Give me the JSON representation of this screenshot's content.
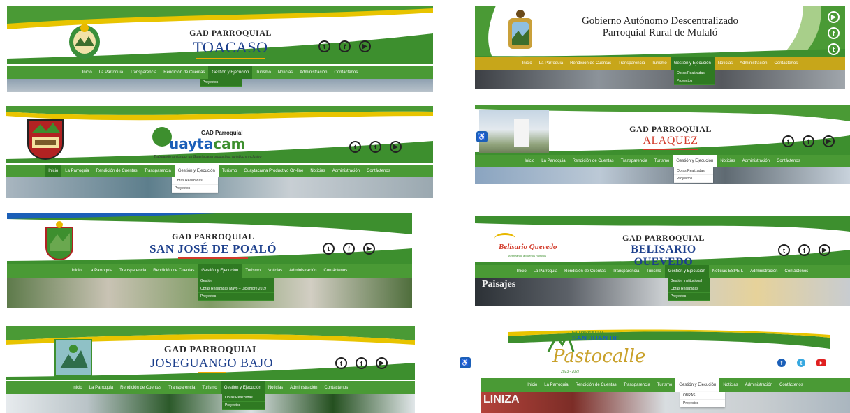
{
  "panels": {
    "toacaso": {
      "title_small": "GAD PARROQUIAL",
      "title_big": "TOACASO",
      "nav": [
        "Inicio",
        "La Parroquia",
        "Transparencia",
        "Rendición de Cuentas",
        "Gestión y Ejecución",
        "Turismo",
        "Noticias",
        "Administración",
        "Contáctenos"
      ],
      "dropdown": [
        "Proyectos"
      ]
    },
    "mulalo": {
      "title_line1": "Gobierno Autónomo Descentralizado",
      "title_line2": "Parroquial Rural de Mulaló",
      "nav": [
        "Inicio",
        "La Parroquia",
        "Rendición de Cuentas",
        "Transparencia",
        "Turismo",
        "Gestión y Ejecución",
        "Noticias",
        "Administración",
        "Contáctenos"
      ],
      "dropdown": [
        "Obras Realizadas",
        "Proyectos"
      ]
    },
    "guaytacama": {
      "logo_prefix": "uayta",
      "logo_suffix": "cam",
      "logo_gad": "GAD Parroquial",
      "tagline": "Trabajando juntos por un Guaytacama productivo, turístico e inclusivo",
      "nav": [
        "Inicio",
        "La Parroquia",
        "Rendición de Cuentas",
        "Transparencia",
        "Gestión y Ejecución",
        "Turismo",
        "Guaytacama Productivo On-line",
        "Noticias",
        "Administración",
        "Contáctenos"
      ],
      "dropdown": [
        "Obras Realizadas",
        "Proyectos"
      ]
    },
    "alaquez": {
      "title_small": "GAD PARROQUIAL",
      "title_big": "ALAQUEZ",
      "nav": [
        "Inicio",
        "La Parroquia",
        "Rendición de Cuentas",
        "Transparencia",
        "Turismo",
        "Gestión y Ejecución",
        "Noticias",
        "Administración",
        "Contáctenos"
      ],
      "dropdown": [
        "Obras Realizadas",
        "Proyectos"
      ]
    },
    "poalo": {
      "title_small": "GAD PARROQUIAL",
      "title_big": "SAN JOSÉ DE POALÓ",
      "nav": [
        "Inicio",
        "La Parroquia",
        "Transparencia",
        "Rendición de Cuentas",
        "Gestión y Ejecución",
        "Turismo",
        "Noticias",
        "Administración",
        "Contáctenos"
      ],
      "dropdown": [
        "Gestión",
        "Obras Realizadas Mayo – Diciembre 2019",
        "Proyectos"
      ]
    },
    "belisario": {
      "logo_text": "Belisario Quevedo",
      "logo_sub": "Avanzando a Buenos Rumbos",
      "title_small": "GAD PARROQUIAL",
      "title_big": "BELISARIO QUEVEDO",
      "nav": [
        "Inicio",
        "La Parroquia",
        "Rendición de Cuentas",
        "Transparencia",
        "Turismo",
        "Gestión y Ejecución",
        "Noticias ESPE-L",
        "Administración",
        "Contáctenos"
      ],
      "dropdown": [
        "Gestión Institucional",
        "Obras Realizadas",
        "Proyectos"
      ],
      "photo_text": "Paisajes"
    },
    "joseguango": {
      "title_small": "GAD PARROQUIAL",
      "title_big": "JOSEGUANGO BAJO",
      "nav": [
        "Inicio",
        "La Parroquia",
        "Rendición de Cuentas",
        "Transparencia",
        "Turismo",
        "Gestión y Ejecución",
        "Noticias",
        "Administración",
        "Contáctenos"
      ],
      "dropdown": [
        "Obras Realizadas",
        "Proyectos"
      ]
    },
    "pastocalle": {
      "logo_gad": "GAD PARROQUIAL",
      "logo_top": "SAN JUAN DE",
      "logo_script": "Pastocalle",
      "logo_years": "2023 - 2027",
      "nav": [
        "Inicio",
        "La Parroquia",
        "Rendición de Cuentas",
        "Transparencia",
        "Turismo",
        "Gestión y Ejecución",
        "Noticias",
        "Administración",
        "Contáctenos"
      ],
      "dropdown": [
        "OBRAS",
        "Proyectos"
      ],
      "photo_text": "LINIZA"
    }
  },
  "colors": {
    "green": "#4a9a35",
    "dark_green": "#2f7a22",
    "gold": "#e8b800",
    "blue_title": "#1c3f8c"
  }
}
